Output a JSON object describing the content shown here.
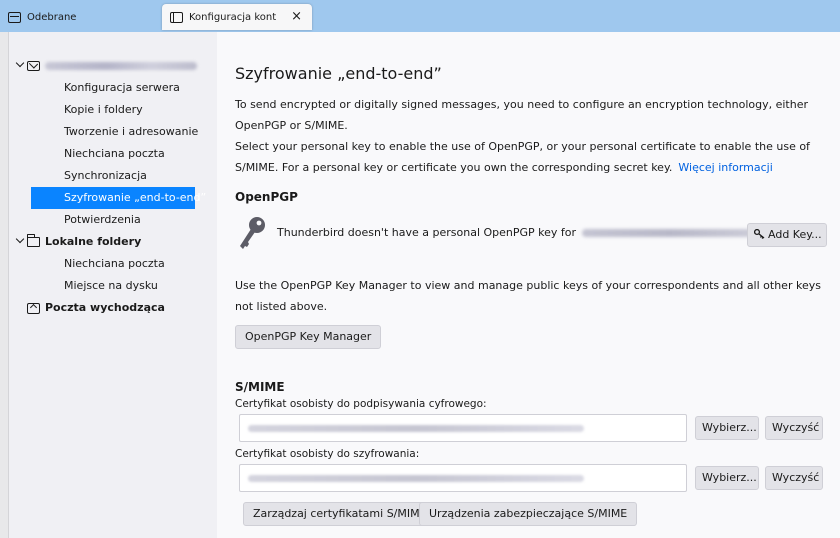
{
  "tabs": [
    {
      "label": "Odebrane",
      "icon": "inbox-icon"
    },
    {
      "label": "Konfiguracja kont",
      "icon": "account-settings-icon",
      "close": "×"
    }
  ],
  "sidebar": {
    "account": {
      "icon": "mail-icon",
      "email_redacted": true
    },
    "account_items": [
      {
        "label": "Konfiguracja serwera"
      },
      {
        "label": "Kopie i foldery"
      },
      {
        "label": "Tworzenie i adresowanie"
      },
      {
        "label": "Niechciana poczta"
      },
      {
        "label": "Synchronizacja"
      },
      {
        "label": "Szyfrowanie „end-to-end”",
        "selected": true
      },
      {
        "label": "Potwierdzenia"
      }
    ],
    "local_folders": {
      "label": "Lokalne foldery",
      "items": [
        {
          "label": "Niechciana poczta"
        },
        {
          "label": "Miejsce na dysku"
        }
      ]
    },
    "outgoing": {
      "label": "Poczta wychodząca"
    }
  },
  "content": {
    "title": "Szyfrowanie „end-to-end”",
    "intro": "To send encrypted or digitally signed messages, you need to configure an encryption technology, either OpenPGP or S/MIME.",
    "select_key": "Select your personal key to enable the use of OpenPGP, or your personal certificate to enable the use of S/MIME. For a personal key or certificate you own the corresponding secret key.",
    "more_info_link": "Więcej informacji",
    "openpgp": {
      "heading": "OpenPGP",
      "no_key_text": "Thunderbird doesn't have a personal OpenPGP key for",
      "add_key_button": "Add Key...",
      "manager_desc": "Use the OpenPGP Key Manager to view and manage public keys of your correspondents and all other keys not listed above.",
      "manager_button": "OpenPGP Key Manager"
    },
    "smime": {
      "heading": "S/MIME",
      "sign_label": "Certyfikat osobisty do podpisywania cyfrowego:",
      "encrypt_label": "Certyfikat osobisty do szyfrowania:",
      "select_button": "Wybierz...",
      "clear_button": "Wyczyść",
      "manage_certs_button": "Zarządzaj certyfikatami S/MIME",
      "security_devices_button": "Urządzenia zabezpieczające S/MIME"
    }
  },
  "colors": {
    "tabbar": "#9fc8ee",
    "selection": "#0a84ff",
    "link": "#0061e0"
  }
}
